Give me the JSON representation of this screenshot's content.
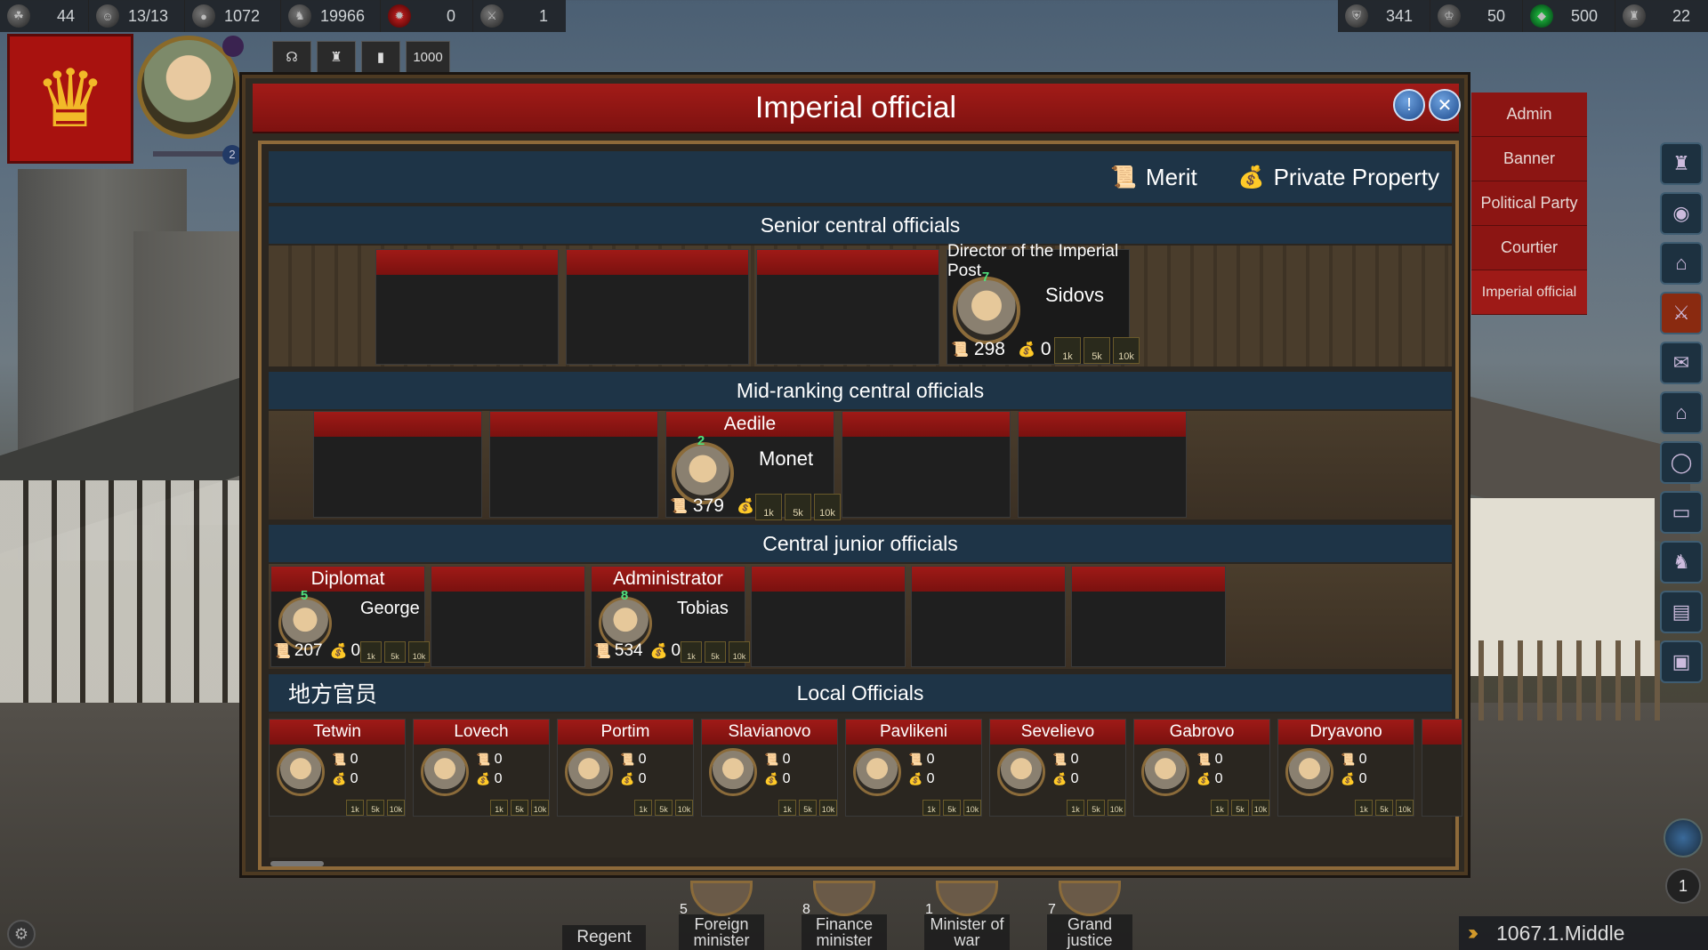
{
  "top_left_resources": [
    {
      "icon": "grain-icon",
      "value": "44"
    },
    {
      "icon": "population-icon",
      "value": "13/13"
    },
    {
      "icon": "gold-icon",
      "value": "1072"
    },
    {
      "icon": "horse-icon",
      "value": "19966"
    },
    {
      "icon": "fire-icon",
      "value": "0"
    },
    {
      "icon": "sword-icon",
      "value": "1"
    }
  ],
  "top_right_resources": [
    {
      "icon": "shield-icon",
      "value": "341"
    },
    {
      "icon": "crown-icon",
      "value": "50"
    },
    {
      "icon": "gem-icon",
      "value": "500"
    },
    {
      "icon": "soldiers-icon",
      "value": "22"
    }
  ],
  "ruler": {
    "level": "2"
  },
  "item_slots": [
    {
      "icon": "ear-icon"
    },
    {
      "icon": "armor-icon"
    },
    {
      "icon": "blank-icon"
    },
    {
      "value": "1000"
    }
  ],
  "right_tabs": [
    "Admin",
    "Banner",
    "Political Party",
    "Courtier",
    "Imperial official"
  ],
  "modal": {
    "title": "Imperial official",
    "merit_label": "Merit",
    "property_label": "Private Property",
    "sections": {
      "senior": "Senior central officials",
      "mid": "Mid-ranking central officials",
      "junior": "Central junior officials",
      "local_cn": "地方官员",
      "local": "Local Officials"
    },
    "senior_official": {
      "title": "Director of the Imperial Post",
      "name": "Sidovs",
      "level": "7",
      "merit": "298",
      "property": "0"
    },
    "mid_official": {
      "title": "Aedile",
      "name": "Monet",
      "level": "2",
      "merit": "379",
      "property": "0"
    },
    "junior_officials": [
      {
        "title": "Diplomat",
        "name": "George",
        "level": "5",
        "merit": "207",
        "property": "0"
      },
      {
        "title": "Administrator",
        "name": "Tobias",
        "level": "8",
        "merit": "534",
        "property": "0"
      }
    ],
    "reward_boxes": [
      "1k",
      "5k",
      "10k"
    ],
    "local_officials": [
      {
        "title": "Tetwin",
        "merit": "0",
        "property": "0"
      },
      {
        "title": "Lovech",
        "merit": "0",
        "property": "0"
      },
      {
        "title": "Portim",
        "merit": "0",
        "property": "0"
      },
      {
        "title": "Slavianovo",
        "merit": "0",
        "property": "0"
      },
      {
        "title": "Pavlikeni",
        "merit": "0",
        "property": "0"
      },
      {
        "title": "Sevelievo",
        "merit": "0",
        "property": "0"
      },
      {
        "title": "Gabrovo",
        "merit": "0",
        "property": "0"
      },
      {
        "title": "Dryavono",
        "merit": "0",
        "property": "0"
      }
    ]
  },
  "bottom": {
    "regent": "Regent",
    "ministers": [
      {
        "num": "5",
        "label": "Foreign minister"
      },
      {
        "num": "8",
        "label": "Finance minister"
      },
      {
        "num": "1",
        "label": "Minister of war"
      },
      {
        "num": "7",
        "label": "Grand justice"
      }
    ],
    "date": "1067.1.Middle",
    "page_num": "1"
  }
}
